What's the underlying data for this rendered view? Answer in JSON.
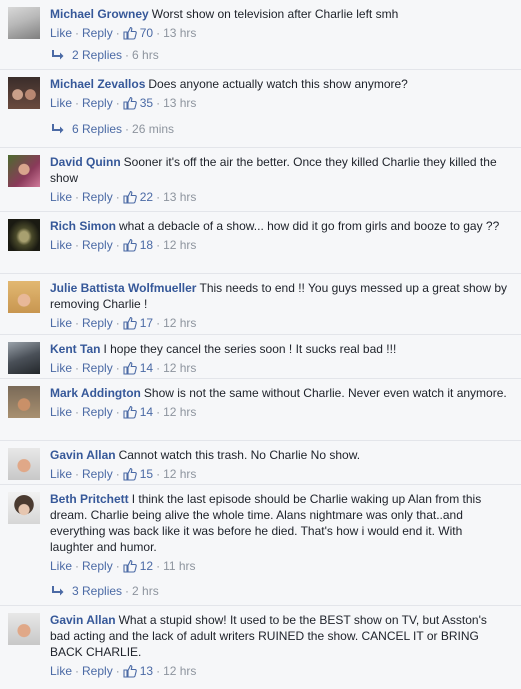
{
  "comments": [
    {
      "author": "Michael Growney",
      "text": "Worst show on television after Charlie left smh",
      "like": "Like",
      "reply": "Reply",
      "likes": "70",
      "time": "13 hrs",
      "replies": "2 Replies",
      "replies_time": "6 hrs"
    },
    {
      "author": "Michael Zevallos",
      "text": "Does anyone actually watch this show anymore?",
      "like": "Like",
      "reply": "Reply",
      "likes": "35",
      "time": "13 hrs",
      "replies": "6 Replies",
      "replies_time": "26 mins"
    },
    {
      "author": "David Quinn",
      "text": "Sooner it's off the air the better. Once they killed Charlie they killed the show",
      "like": "Like",
      "reply": "Reply",
      "likes": "22",
      "time": "13 hrs"
    },
    {
      "author": "Rich Simon",
      "text": "what a debacle of a show... how did it go from girls and booze to gay ??",
      "like": "Like",
      "reply": "Reply",
      "likes": "18",
      "time": "12 hrs"
    },
    {
      "author": "Julie Battista Wolfmueller",
      "text": "This needs to end !! You guys messed up a great show by removing Charlie !",
      "like": "Like",
      "reply": "Reply",
      "likes": "17",
      "time": "12 hrs"
    },
    {
      "author": "Kent Tan",
      "text": "I hope they cancel the series soon ! It sucks real bad !!!",
      "like": "Like",
      "reply": "Reply",
      "likes": "14",
      "time": "12 hrs"
    },
    {
      "author": "Mark Addington",
      "text": "Show is not the same without Charlie. Never even watch it anymore.",
      "like": "Like",
      "reply": "Reply",
      "likes": "14",
      "time": "12 hrs"
    },
    {
      "author": "Gavin Allan",
      "text": "Cannot watch this trash. No Charlie No show.",
      "like": "Like",
      "reply": "Reply",
      "likes": "15",
      "time": "12 hrs"
    },
    {
      "author": "Beth Pritchett",
      "text": "I think the last episode should be Charlie waking up Alan from this dream. Charlie being alive the whole time. Alans nightmare was only that..and everything was back like it was before he died. That's how i would end it. With laughter and humor.",
      "like": "Like",
      "reply": "Reply",
      "likes": "12",
      "time": "11 hrs",
      "replies": "3 Replies",
      "replies_time": "2 hrs"
    },
    {
      "author": "Gavin Allan",
      "text": "What a stupid show! It used to be the BEST show on TV, but Asston's bad acting and the lack of adult writers RUINED the show. CANCEL IT or BRING BACK CHARLIE.",
      "like": "Like",
      "reply": "Reply",
      "likes": "13",
      "time": "12 hrs"
    }
  ],
  "colors": {
    "author": "#365899",
    "link": "#4b6aa5",
    "meta": "#8d949e",
    "background": "#f6f7f9"
  }
}
